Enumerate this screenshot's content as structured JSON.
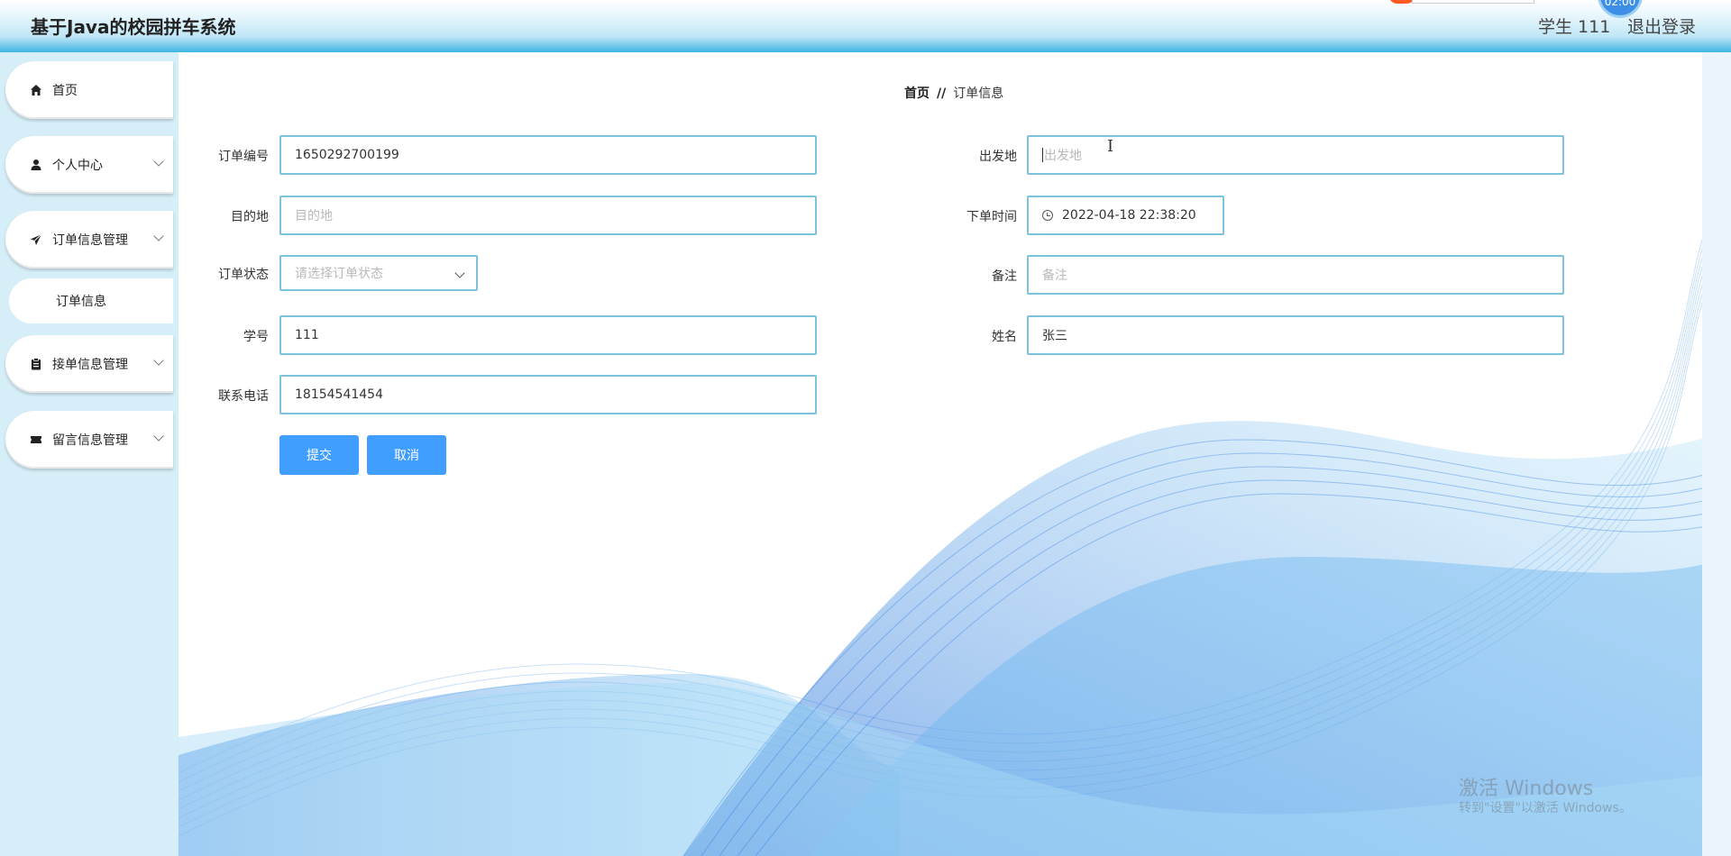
{
  "header": {
    "title": "基于Java的校园拼车系统",
    "user_label": "学生 111",
    "logout_label": "退出登录",
    "clock_text": "02:00"
  },
  "sidebar": {
    "items": [
      {
        "label": "首页",
        "icon": "home-icon"
      },
      {
        "label": "个人中心",
        "icon": "user-icon"
      },
      {
        "label": "订单信息管理",
        "icon": "paper-plane-icon"
      },
      {
        "label": "订单信息",
        "icon": ""
      },
      {
        "label": "接单信息管理",
        "icon": "clipboard-icon"
      },
      {
        "label": "留言信息管理",
        "icon": "ticket-icon"
      }
    ]
  },
  "breadcrumb": {
    "home": "首页",
    "separator": "//",
    "current": "订单信息"
  },
  "form": {
    "order_no": {
      "label": "订单编号",
      "value": "1650292700199"
    },
    "departure": {
      "label": "出发地",
      "placeholder": "出发地"
    },
    "destination": {
      "label": "目的地",
      "placeholder": "目的地"
    },
    "order_time": {
      "label": "下单时间",
      "value": "2022-04-18 22:38:20"
    },
    "status": {
      "label": "订单状态",
      "placeholder": "请选择订单状态"
    },
    "remark": {
      "label": "备注",
      "placeholder": "备注"
    },
    "student_no": {
      "label": "学号",
      "value": "111"
    },
    "name": {
      "label": "姓名",
      "value": "张三"
    },
    "phone": {
      "label": "联系电话",
      "value": "18154541454"
    },
    "submit_label": "提交",
    "cancel_label": "取消"
  },
  "watermark": {
    "line1": "激活 Windows",
    "line2": "转到\"设置\"以激活 Windows。"
  },
  "colors": {
    "primary_button": "#409eff",
    "input_border": "#7cc3de",
    "sidebar_bg": "#d6eef8",
    "header_bottom": "#3fb4e3"
  }
}
